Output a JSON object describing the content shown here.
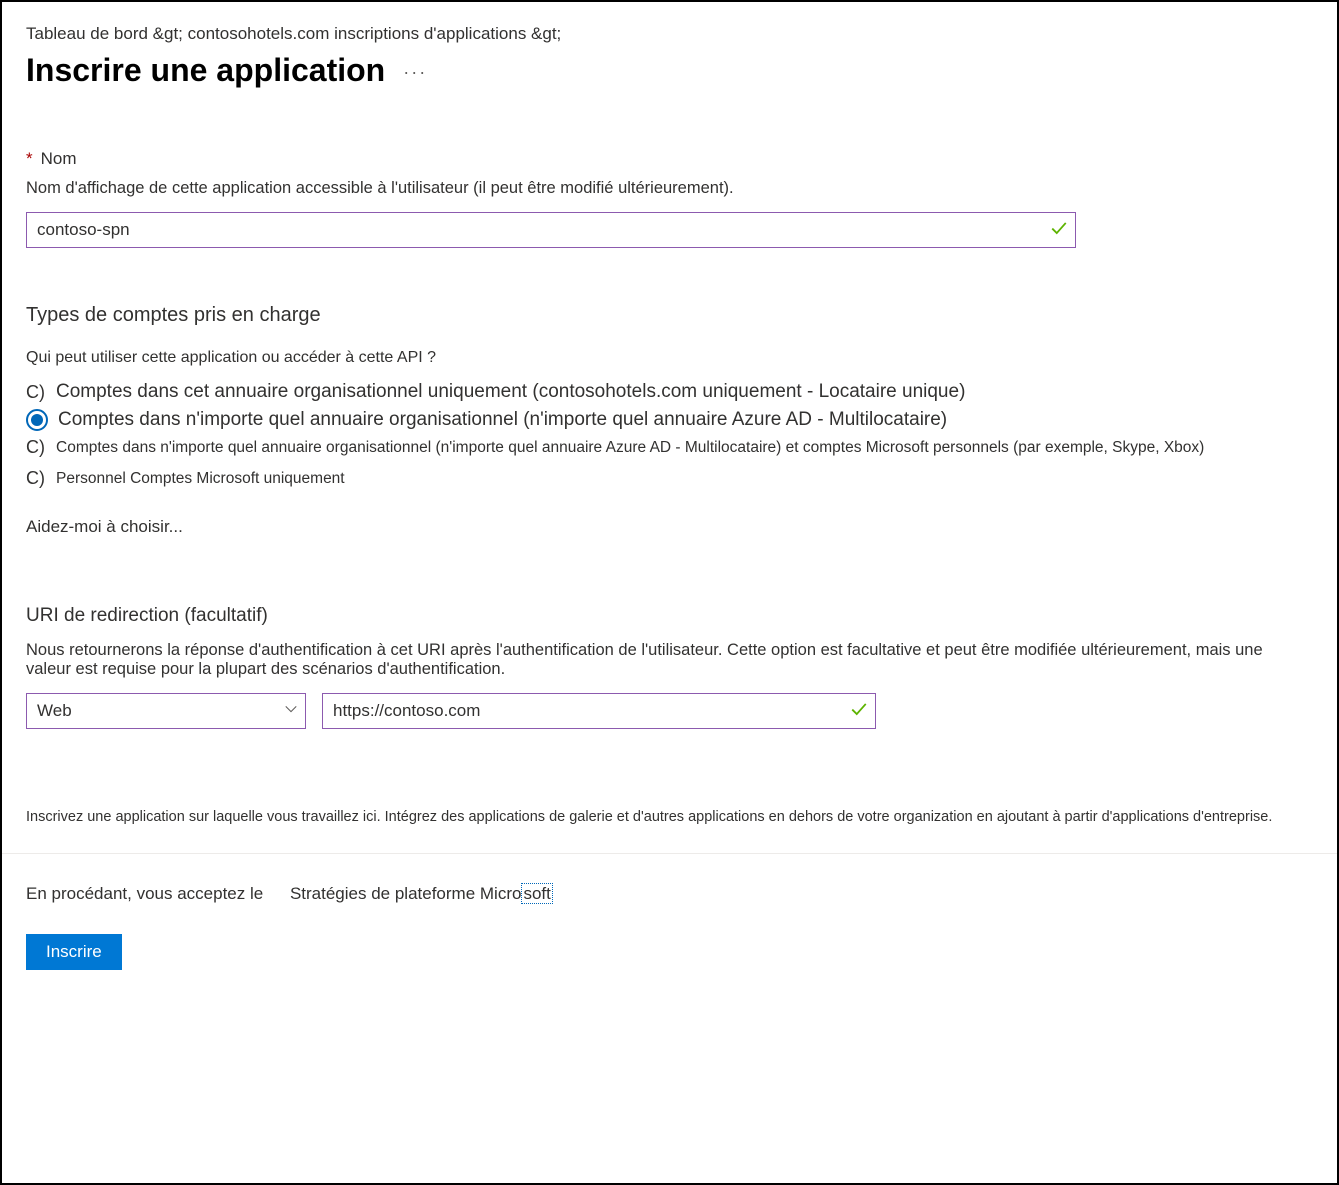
{
  "breadcrumb": "Tableau de bord &gt; contosohotels.com inscriptions d'applications &gt;",
  "page_title": "Inscrire une application",
  "more_icon": "···",
  "name_section": {
    "label": "Nom",
    "required_mark": "*",
    "description": "Nom d'affichage de cette application accessible à l'utilisateur (il peut être modifié ultérieurement).",
    "value": "contoso-spn"
  },
  "account_types": {
    "heading": "Types de comptes pris en charge",
    "question": "Qui peut utiliser cette application ou accéder à cette API ?",
    "options": [
      {
        "prefix": "C)",
        "label": "Comptes dans cet annuaire organisationnel uniquement (contosohotels.com uniquement - Locataire unique)",
        "selected": false,
        "large": true
      },
      {
        "prefix": "",
        "label": "Comptes dans n'importe quel annuaire organisationnel (n'importe quel annuaire Azure AD - Multilocataire)",
        "selected": true,
        "large": true
      },
      {
        "prefix": "C)",
        "label": "Comptes dans n'importe quel annuaire organisationnel (n'importe quel annuaire Azure AD - Multilocataire) et comptes Microsoft personnels (par exemple, Skype, Xbox)",
        "selected": false,
        "large": false
      },
      {
        "prefix": "C)",
        "label": "Personnel   Comptes Microsoft uniquement",
        "selected": false,
        "large": false
      }
    ],
    "help_link": "Aidez-moi à choisir..."
  },
  "redirect": {
    "heading": "URI de redirection (facultatif)",
    "description": "Nous retournerons la réponse d'authentification à cet URI après l'authentification de l'utilisateur. Cette option est facultative et peut être modifiée ultérieurement, mais une valeur est requise pour la plupart des scénarios d'authentification.",
    "platform_value": "Web",
    "url_value": "https://contoso.com"
  },
  "footer_note": "Inscrivez une application sur laquelle vous travaillez ici. Intégrez des applications de galerie et d'autres applications en dehors de votre organization en ajoutant à partir d'applications d'entreprise.",
  "accept": {
    "prefix": "En procédant, vous acceptez le",
    "link_text_pre": "Stratégies de plateforme Micro",
    "link_text_boxed": "soft"
  },
  "register_button": "Inscrire"
}
